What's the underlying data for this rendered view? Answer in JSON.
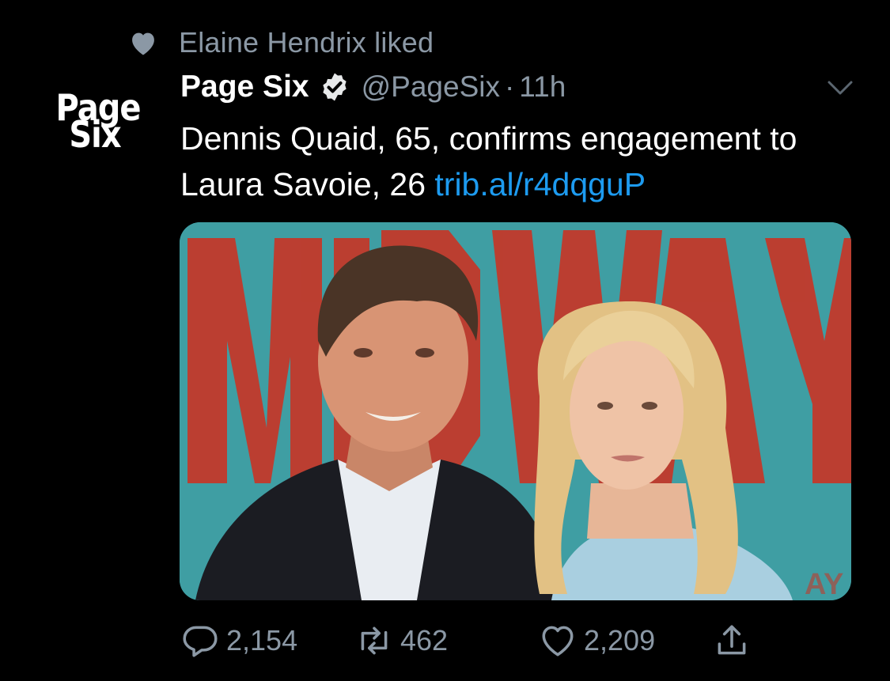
{
  "social_context": {
    "text": "Elaine Hendrix liked",
    "icon": "heart-icon"
  },
  "avatar": {
    "line1": "Page",
    "line2": "Six"
  },
  "header": {
    "display_name": "Page Six",
    "verified_icon": "verified-badge-icon",
    "handle": "@PageSix",
    "separator": "·",
    "time": "11h",
    "menu_icon": "chevron-down-icon"
  },
  "tweet": {
    "text": "Dennis Quaid, 65, confirms engagement to Laura Savoie, 26 ",
    "link": "trib.al/r4dqguP"
  },
  "media": {
    "backdrop_letters": "MIDWAY",
    "corner_text": "AY"
  },
  "actions": {
    "replies": "2,154",
    "retweets": "462",
    "likes": "2,209"
  },
  "colors": {
    "background": "#000000",
    "secondary_text": "#8b98a5",
    "link": "#1d9bf0",
    "backdrop_teal": "#3f9ea3",
    "backdrop_red": "#c2392b"
  }
}
